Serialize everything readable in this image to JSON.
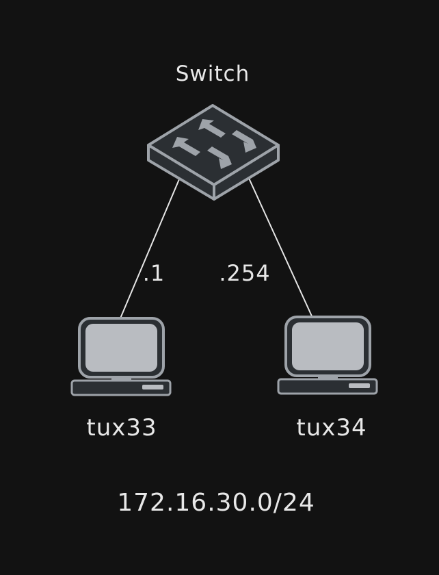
{
  "diagram": {
    "switch": {
      "label": "Switch"
    },
    "hosts": [
      {
        "label": "tux33",
        "ip_suffix": ".1"
      },
      {
        "label": "tux34",
        "ip_suffix": ".254"
      }
    ],
    "network": {
      "label": "172.16.30.0/24"
    },
    "colors": {
      "background": "#121212",
      "text": "#e8e8e8",
      "link": "#e6e6e6",
      "device_outline": "#9ea3a9",
      "device_dark": "#2b2f33",
      "screen": "#b9bcc1",
      "arrow": "#9ea3a9"
    }
  }
}
